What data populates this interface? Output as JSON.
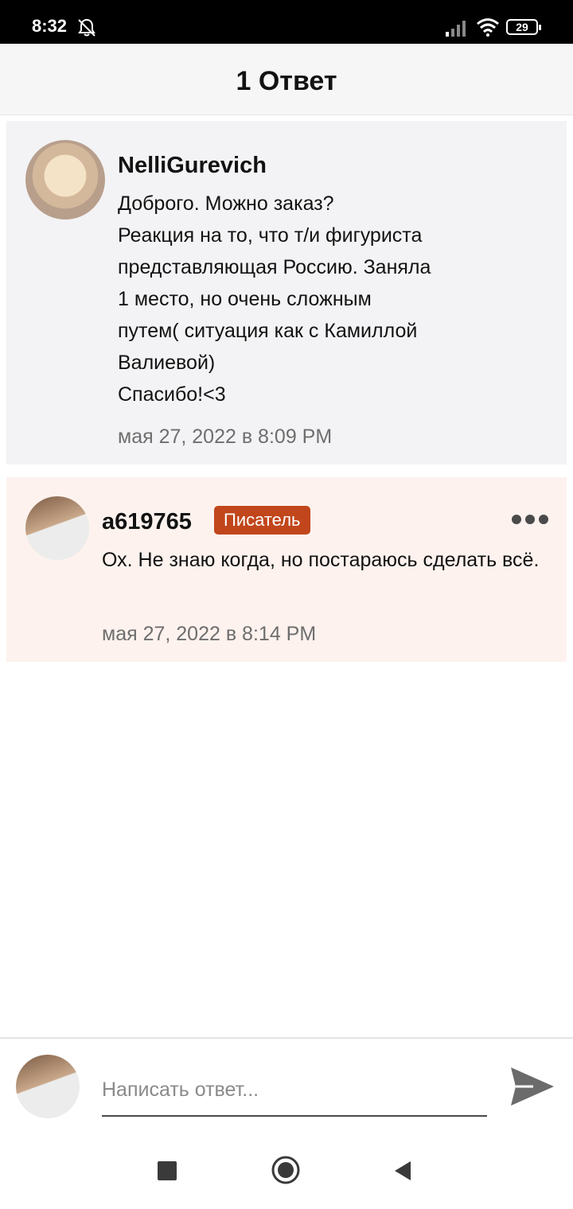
{
  "status_bar": {
    "time": "8:32",
    "battery": "29",
    "icons": [
      "bell-off-icon",
      "signal-icon",
      "wifi-icon",
      "battery-icon"
    ]
  },
  "header": {
    "title": "1 Ответ"
  },
  "comments": [
    {
      "username": "NelliGurevich",
      "text": "Доброго. Можно заказ?\nРеакция на то, что т/и фигуриста\nпредставляющая Россию. Заняла\n1 место, но очень сложным\nпутем( ситуация как с Камиллой\nВалиевой)\nСпасибо!<3",
      "timestamp": "мая 27, 2022 в 8:09 PM"
    },
    {
      "username": "a619765",
      "badge": "Писатель",
      "text": "Ох. Не знаю когда, но постараюсь сделать всё.",
      "timestamp": "мая 27, 2022 в 8:14 PM",
      "more_icon": "more-horizontal-icon"
    }
  ],
  "reply": {
    "placeholder": "Написать ответ...",
    "value": "",
    "send_icon": "send-icon"
  },
  "colors": {
    "badge": "#c1461c",
    "comment_bg_1": "#f3f3f5",
    "comment_bg_2": "#fdf2ee"
  }
}
